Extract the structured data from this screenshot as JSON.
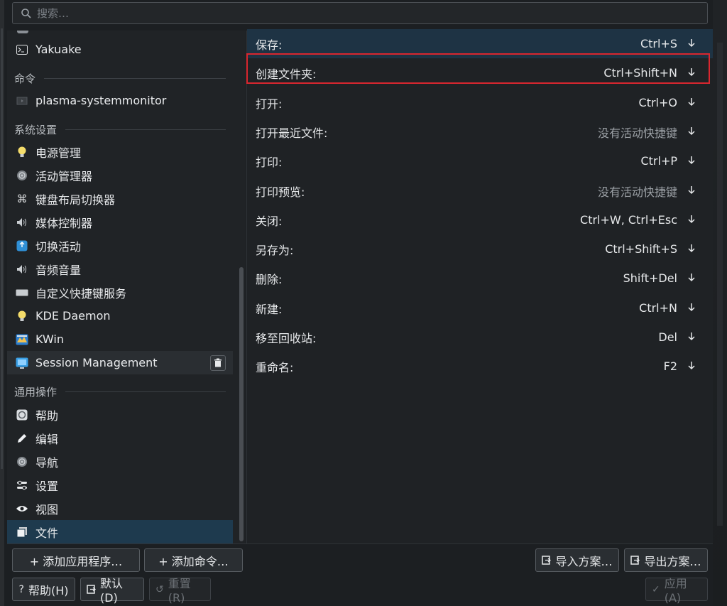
{
  "search": {
    "placeholder": "搜索…"
  },
  "sidebar": {
    "items_top": [
      {
        "label": "Yakuake",
        "icon": "terminal-icon"
      }
    ],
    "headers": {
      "commands": "命令",
      "system_settings": "系统设置",
      "common_actions": "通用操作"
    },
    "commands": [
      {
        "label": "plasma-systemmonitor",
        "icon": "monitor-icon"
      }
    ],
    "system": [
      {
        "label": "电源管理",
        "icon": "lightbulb-icon"
      },
      {
        "label": "活动管理器",
        "icon": "activity-icon"
      },
      {
        "label": "键盘布局切换器",
        "icon": "command-key-icon"
      },
      {
        "label": "媒体控制器",
        "icon": "speaker-icon"
      },
      {
        "label": "切换活动",
        "icon": "switch-activity-icon"
      },
      {
        "label": "音频音量",
        "icon": "speaker-icon"
      },
      {
        "label": "自定义快捷键服务",
        "icon": "keyboard-icon"
      },
      {
        "label": "KDE Daemon",
        "icon": "lightbulb-icon"
      },
      {
        "label": "KWin",
        "icon": "kwin-icon"
      },
      {
        "label": "Session Management",
        "icon": "session-icon"
      }
    ],
    "common": [
      {
        "label": "帮助",
        "icon": "help-icon"
      },
      {
        "label": "编辑",
        "icon": "pencil-icon"
      },
      {
        "label": "导航",
        "icon": "navigation-icon"
      },
      {
        "label": "设置",
        "icon": "settings-icon"
      },
      {
        "label": "视图",
        "icon": "eye-icon"
      },
      {
        "label": "文件",
        "icon": "file-icon"
      }
    ]
  },
  "shortcuts": [
    {
      "label": "保存:",
      "keys": "Ctrl+S"
    },
    {
      "label": "创建文件夹:",
      "keys": "Ctrl+Shift+N"
    },
    {
      "label": "打开:",
      "keys": "Ctrl+O"
    },
    {
      "label": "打开最近文件:",
      "keys": "没有活动快捷键"
    },
    {
      "label": "打印:",
      "keys": "Ctrl+P"
    },
    {
      "label": "打印预览:",
      "keys": "没有活动快捷键"
    },
    {
      "label": "关闭:",
      "keys": "Ctrl+W, Ctrl+Esc"
    },
    {
      "label": "另存为:",
      "keys": "Ctrl+Shift+S"
    },
    {
      "label": "删除:",
      "keys": "Shift+Del"
    },
    {
      "label": "新建:",
      "keys": "Ctrl+N"
    },
    {
      "label": "移至回收站:",
      "keys": "Del"
    },
    {
      "label": "重命名:",
      "keys": "F2"
    }
  ],
  "buttons": {
    "add_app": "+ 添加应用程序…",
    "add_command": "+ 添加命令…",
    "import": "导入方案…",
    "export": "导出方案…",
    "help": "帮助(H)",
    "defaults": "默认(D)",
    "reset": "重置(R)",
    "apply": "应用(A)",
    "help_glyph": "?",
    "reset_glyph": "↺",
    "apply_glyph": "✓"
  },
  "colors": {
    "selection": "#1e3a4e",
    "highlight_box": "#d9262f",
    "background": "#1c1f22"
  }
}
